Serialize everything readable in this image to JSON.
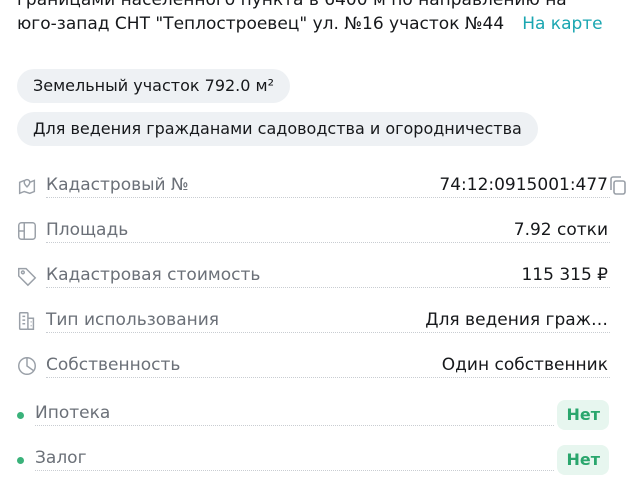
{
  "address": {
    "line1": "границами населенного пункта в 6400 м по направлению на",
    "line2": "юго-запад СНТ \"Теплостроевец\" ул. №16 участок №44",
    "map_link": "На карте"
  },
  "chips": {
    "area": "Земельный участок 792.0 м²",
    "purpose": "Для ведения гражданами садоводства и огородничества"
  },
  "details": [
    {
      "icon": "map-pin-icon",
      "label": "Кадастровый №",
      "value": "74:12:0915001:477"
    },
    {
      "icon": "area-icon",
      "label": "Площадь",
      "value": "7.92 сотки"
    },
    {
      "icon": "price-tag-icon",
      "label": "Кадастровая стоимость",
      "value": "115 315 ₽"
    },
    {
      "icon": "buildings-icon",
      "label": "Тип использования",
      "value": "Для ведения граж…"
    },
    {
      "icon": "pie-chart-icon",
      "label": "Собственность",
      "value": "Один собственник"
    }
  ],
  "flags": [
    {
      "label": "Ипотека",
      "value": "Нет"
    },
    {
      "label": "Залог",
      "value": "Нет"
    }
  ],
  "colors": {
    "accent": "#1aa6b1",
    "success": "#2aa66d",
    "chip_bg": "#eef1f4"
  }
}
